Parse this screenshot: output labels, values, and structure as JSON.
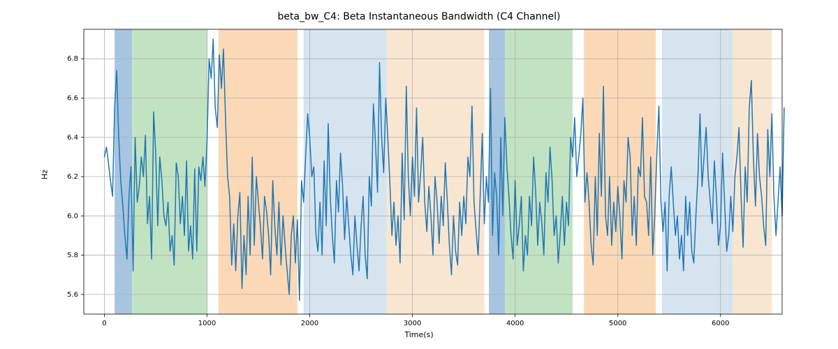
{
  "chart_data": {
    "type": "line",
    "title": "beta_bw_C4: Beta Instantaneous Bandwidth (C4 Channel)",
    "xlabel": "Time(s)",
    "ylabel": "Hz",
    "xlim": [
      -200,
      6600
    ],
    "ylim": [
      5.5,
      6.95
    ],
    "x_ticks": [
      0,
      1000,
      2000,
      3000,
      4000,
      5000,
      6000
    ],
    "y_ticks": [
      5.6,
      5.8,
      6.0,
      6.2,
      6.4,
      6.6,
      6.8
    ],
    "bands": [
      {
        "start": 100,
        "end": 270,
        "color": "#a7c4e0",
        "label": "blue"
      },
      {
        "start": 270,
        "end": 1005,
        "color": "#c2e3c2",
        "label": "green"
      },
      {
        "start": 1110,
        "end": 1880,
        "color": "#fcd9b6",
        "label": "orange"
      },
      {
        "start": 1940,
        "end": 2750,
        "color": "#d6e4f0",
        "label": "lightblue"
      },
      {
        "start": 2750,
        "end": 3700,
        "color": "#f9e6d1",
        "label": "lightorange"
      },
      {
        "start": 3745,
        "end": 3900,
        "color": "#a7c4e0",
        "label": "blue"
      },
      {
        "start": 3900,
        "end": 4560,
        "color": "#c2e3c2",
        "label": "green"
      },
      {
        "start": 4670,
        "end": 5370,
        "color": "#fcd9b6",
        "label": "orange"
      },
      {
        "start": 5430,
        "end": 6120,
        "color": "#d6e4f0",
        "label": "lightblue"
      },
      {
        "start": 6120,
        "end": 6500,
        "color": "#f9e6d1",
        "label": "lightorange"
      }
    ],
    "series": [
      {
        "name": "beta_bw_C4",
        "x_start": 0,
        "x_step": 20,
        "values": [
          6.3,
          6.35,
          6.27,
          6.18,
          6.1,
          6.55,
          6.74,
          6.4,
          6.18,
          6.05,
          5.9,
          5.78,
          6.1,
          6.25,
          5.72,
          6.4,
          6.07,
          6.15,
          6.3,
          6.2,
          6.41,
          5.96,
          6.1,
          5.78,
          6.53,
          6.32,
          5.95,
          6.3,
          6.18,
          6.0,
          5.95,
          6.07,
          5.82,
          5.9,
          5.75,
          6.27,
          6.2,
          5.96,
          6.1,
          5.9,
          6.28,
          5.82,
          5.95,
          5.78,
          6.24,
          5.82,
          6.25,
          6.18,
          6.3,
          6.15,
          6.38,
          6.8,
          6.7,
          6.9,
          6.55,
          6.45,
          6.82,
          6.65,
          6.85,
          6.5,
          6.2,
          6.1,
          5.75,
          5.96,
          5.72,
          6.0,
          6.12,
          5.63,
          5.9,
          5.7,
          6.1,
          5.8,
          6.3,
          5.85,
          6.2,
          6.07,
          5.95,
          5.78,
          6.1,
          6.02,
          5.9,
          5.7,
          6.18,
          5.95,
          5.8,
          6.07,
          5.75,
          6.0,
          5.85,
          5.72,
          5.6,
          5.9,
          6.0,
          5.76,
          5.98,
          5.57,
          6.18,
          6.07,
          6.3,
          6.52,
          6.4,
          6.2,
          6.25,
          5.9,
          5.82,
          6.07,
          5.8,
          6.28,
          5.95,
          6.47,
          6.1,
          5.9,
          5.76,
          6.18,
          6.02,
          6.32,
          6.15,
          5.88,
          6.1,
          5.95,
          5.8,
          5.7,
          6.0,
          5.85,
          5.72,
          5.95,
          6.1,
          5.8,
          5.68,
          6.2,
          6.05,
          6.57,
          6.38,
          6.12,
          6.78,
          6.4,
          6.22,
          6.6,
          6.4,
          6.18,
          5.9,
          6.07,
          5.85,
          6.0,
          5.76,
          6.32,
          5.98,
          6.66,
          6.2,
          6.0,
          6.3,
          6.1,
          6.55,
          6.07,
          6.22,
          6.4,
          6.07,
          5.92,
          6.15,
          6.0,
          5.8,
          6.2,
          6.07,
          5.86,
          6.1,
          5.95,
          6.27,
          6.07,
          5.85,
          5.7,
          6.0,
          5.82,
          5.75,
          6.07,
          5.9,
          6.1,
          5.96,
          6.3,
          6.2,
          6.56,
          6.07,
          5.92,
          5.8,
          6.1,
          6.42,
          5.96,
          6.2,
          6.07,
          6.65,
          5.9,
          6.22,
          6.1,
          5.8,
          6.4,
          6.0,
          6.5,
          6.25,
          6.1,
          5.9,
          5.78,
          6.18,
          5.85,
          5.95,
          6.1,
          5.72,
          5.9,
          5.8,
          6.1,
          5.95,
          6.3,
          6.12,
          5.85,
          6.07,
          5.96,
          5.8,
          6.22,
          6.07,
          6.35,
          6.18,
          5.9,
          6.0,
          5.76,
          5.92,
          6.1,
          5.85,
          6.07,
          5.95,
          6.4,
          6.3,
          6.5,
          6.2,
          6.3,
          6.42,
          6.6,
          6.07,
          6.22,
          6.07,
          5.85,
          5.75,
          6.2,
          5.9,
          6.42,
          6.1,
          6.66,
          6.0,
          5.9,
          6.2,
          5.85,
          6.07,
          5.92,
          6.15,
          6.0,
          5.78,
          6.18,
          6.07,
          6.4,
          6.3,
          5.9,
          6.1,
          5.85,
          6.25,
          6.2,
          6.5,
          6.1,
          6.07,
          5.9,
          6.3,
          5.8,
          6.0,
          6.32,
          6.56,
          6.07,
          5.92,
          6.07,
          5.72,
          6.1,
          6.25,
          6.07,
          5.9,
          6.0,
          5.78,
          5.9,
          5.72,
          6.1,
          5.9,
          6.07,
          5.82,
          5.76,
          6.0,
          6.2,
          6.52,
          6.15,
          6.3,
          6.45,
          6.2,
          6.07,
          5.96,
          6.28,
          6.1,
          5.85,
          5.95,
          6.32,
          6.07,
          5.82,
          5.9,
          6.1,
          5.92,
          6.2,
          6.3,
          6.45,
          6.1,
          5.84,
          6.25,
          6.07,
          6.55,
          6.69,
          6.3,
          6.05,
          6.42,
          6.2,
          6.1,
          5.95,
          5.85,
          6.44,
          6.2,
          6.52,
          6.1,
          5.9,
          6.07,
          6.25,
          6.0,
          6.55
        ]
      }
    ]
  }
}
